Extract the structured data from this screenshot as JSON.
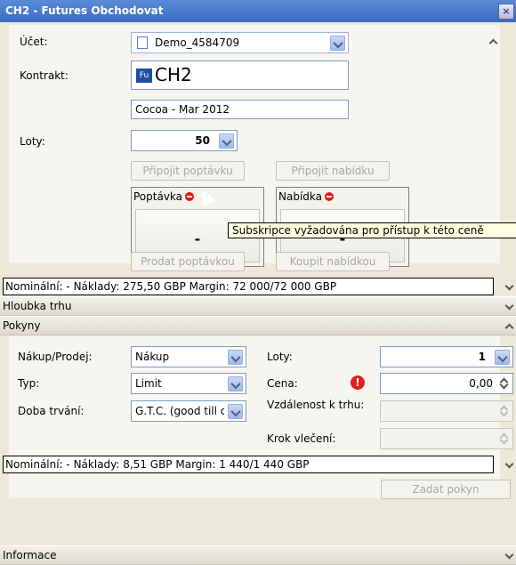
{
  "window": {
    "title": "CH2 - Futures Obchodovat"
  },
  "account": {
    "label": "Účet:",
    "value": "Demo_4584709"
  },
  "contract": {
    "label": "Kontrakt:",
    "badge": "Fu",
    "symbol": "CH2",
    "description": "Cocoa - Mar 2012"
  },
  "lots": {
    "label": "Loty:",
    "value": "50"
  },
  "buttons": {
    "attach_bid": "Připojit poptávku",
    "attach_ask": "Připojit nabídku",
    "sell_bid": "Prodat poptávkou",
    "buy_ask": "Koupit nabídkou"
  },
  "prices": {
    "bid_label": "Poptávka",
    "bid_value": "-",
    "ask_label": "Nabídka",
    "ask_value": "-"
  },
  "tooltip": "Subskripce vyžadována pro přístup k této ceně",
  "summary1": "Nominální: - Náklady: 275,50 GBP   Margin: 72 000/72 000 GBP",
  "sections": {
    "depth": "Hloubka trhu",
    "orders": "Pokyny",
    "info": "Informace"
  },
  "orders": {
    "side_label": "Nákup/Prodej:",
    "side_value": "Nákup",
    "type_label": "Typ:",
    "type_value": "Limit",
    "duration_label": "Doba trvání:",
    "duration_value": "G.T.C. (good till c",
    "lots_label": "Loty:",
    "lots_value": "1",
    "price_label": "Cena:",
    "price_value": "0,00",
    "distance_label": "Vzdálenost k trhu:",
    "trail_label": "Krok vlečení:",
    "submit": "Zadat pokyn"
  },
  "summary2": "Nominální: - Náklady: 8,51 GBP   Margin: 1 440/1 440 GBP",
  "colors": {
    "titlebar": "#3a6bc4",
    "tooltip": "#ffffe1",
    "warning": "#e02020"
  }
}
